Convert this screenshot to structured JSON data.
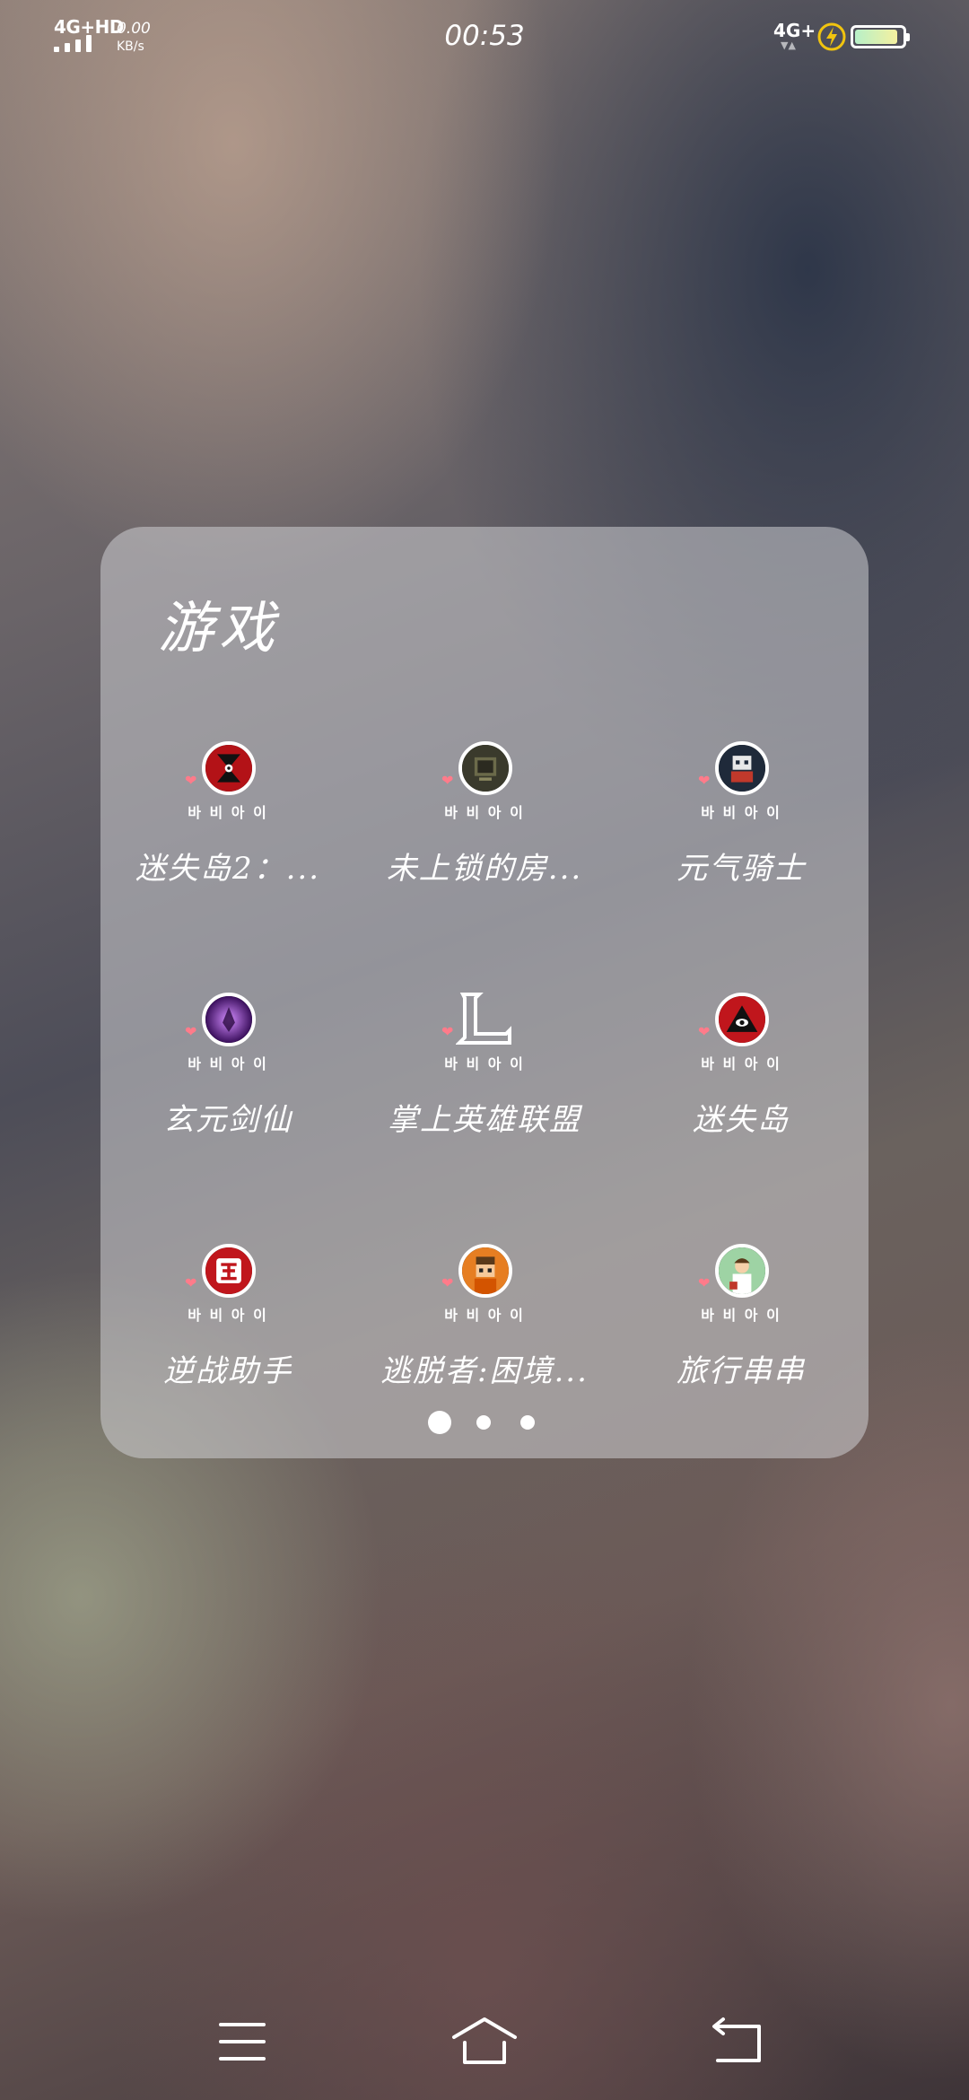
{
  "status_bar": {
    "network_left": "4G+HD",
    "speed_value": "0.00",
    "speed_unit": "KB/s",
    "time": "00:53",
    "network_right": "4G+",
    "battery_level": 0.9,
    "charging": true
  },
  "folder": {
    "title": "游戏",
    "deco_text": "바 비 아 이",
    "apps": [
      {
        "label": "迷失岛2：...",
        "icon": "lost-island-2-icon"
      },
      {
        "label": "未上锁的房...",
        "icon": "unlocked-room-icon"
      },
      {
        "label": "元气骑士",
        "icon": "soul-knight-icon"
      },
      {
        "label": "玄元剑仙",
        "icon": "xuanyuan-sword-icon"
      },
      {
        "label": "掌上英雄联盟",
        "icon": "league-of-legends-icon"
      },
      {
        "label": "迷失岛",
        "icon": "lost-island-icon"
      },
      {
        "label": "逆战助手",
        "icon": "nizhan-assistant-icon"
      },
      {
        "label": "逃脱者:困境...",
        "icon": "escapists-icon"
      },
      {
        "label": "旅行串串",
        "icon": "travel-chuanchuan-icon"
      }
    ],
    "page_count": 3,
    "current_page": 1
  },
  "nav_bar": {
    "buttons": [
      "menu-icon",
      "home-icon",
      "back-icon"
    ]
  },
  "colors": {
    "panel": "#cdcdd2",
    "heart": "#ff7b8a",
    "battery_fill": "#d8f2b4"
  }
}
